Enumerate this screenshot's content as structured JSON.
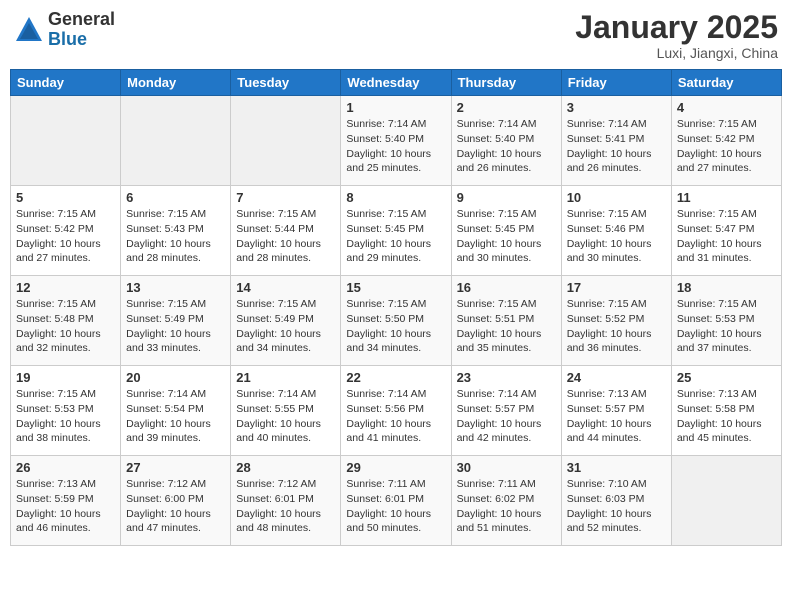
{
  "header": {
    "logo_general": "General",
    "logo_blue": "Blue",
    "month_title": "January 2025",
    "location": "Luxi, Jiangxi, China"
  },
  "weekdays": [
    "Sunday",
    "Monday",
    "Tuesday",
    "Wednesday",
    "Thursday",
    "Friday",
    "Saturday"
  ],
  "weeks": [
    [
      {
        "day": "",
        "info": ""
      },
      {
        "day": "",
        "info": ""
      },
      {
        "day": "",
        "info": ""
      },
      {
        "day": "1",
        "info": "Sunrise: 7:14 AM\nSunset: 5:40 PM\nDaylight: 10 hours\nand 25 minutes."
      },
      {
        "day": "2",
        "info": "Sunrise: 7:14 AM\nSunset: 5:40 PM\nDaylight: 10 hours\nand 26 minutes."
      },
      {
        "day": "3",
        "info": "Sunrise: 7:14 AM\nSunset: 5:41 PM\nDaylight: 10 hours\nand 26 minutes."
      },
      {
        "day": "4",
        "info": "Sunrise: 7:15 AM\nSunset: 5:42 PM\nDaylight: 10 hours\nand 27 minutes."
      }
    ],
    [
      {
        "day": "5",
        "info": "Sunrise: 7:15 AM\nSunset: 5:42 PM\nDaylight: 10 hours\nand 27 minutes."
      },
      {
        "day": "6",
        "info": "Sunrise: 7:15 AM\nSunset: 5:43 PM\nDaylight: 10 hours\nand 28 minutes."
      },
      {
        "day": "7",
        "info": "Sunrise: 7:15 AM\nSunset: 5:44 PM\nDaylight: 10 hours\nand 28 minutes."
      },
      {
        "day": "8",
        "info": "Sunrise: 7:15 AM\nSunset: 5:45 PM\nDaylight: 10 hours\nand 29 minutes."
      },
      {
        "day": "9",
        "info": "Sunrise: 7:15 AM\nSunset: 5:45 PM\nDaylight: 10 hours\nand 30 minutes."
      },
      {
        "day": "10",
        "info": "Sunrise: 7:15 AM\nSunset: 5:46 PM\nDaylight: 10 hours\nand 30 minutes."
      },
      {
        "day": "11",
        "info": "Sunrise: 7:15 AM\nSunset: 5:47 PM\nDaylight: 10 hours\nand 31 minutes."
      }
    ],
    [
      {
        "day": "12",
        "info": "Sunrise: 7:15 AM\nSunset: 5:48 PM\nDaylight: 10 hours\nand 32 minutes."
      },
      {
        "day": "13",
        "info": "Sunrise: 7:15 AM\nSunset: 5:49 PM\nDaylight: 10 hours\nand 33 minutes."
      },
      {
        "day": "14",
        "info": "Sunrise: 7:15 AM\nSunset: 5:49 PM\nDaylight: 10 hours\nand 34 minutes."
      },
      {
        "day": "15",
        "info": "Sunrise: 7:15 AM\nSunset: 5:50 PM\nDaylight: 10 hours\nand 34 minutes."
      },
      {
        "day": "16",
        "info": "Sunrise: 7:15 AM\nSunset: 5:51 PM\nDaylight: 10 hours\nand 35 minutes."
      },
      {
        "day": "17",
        "info": "Sunrise: 7:15 AM\nSunset: 5:52 PM\nDaylight: 10 hours\nand 36 minutes."
      },
      {
        "day": "18",
        "info": "Sunrise: 7:15 AM\nSunset: 5:53 PM\nDaylight: 10 hours\nand 37 minutes."
      }
    ],
    [
      {
        "day": "19",
        "info": "Sunrise: 7:15 AM\nSunset: 5:53 PM\nDaylight: 10 hours\nand 38 minutes."
      },
      {
        "day": "20",
        "info": "Sunrise: 7:14 AM\nSunset: 5:54 PM\nDaylight: 10 hours\nand 39 minutes."
      },
      {
        "day": "21",
        "info": "Sunrise: 7:14 AM\nSunset: 5:55 PM\nDaylight: 10 hours\nand 40 minutes."
      },
      {
        "day": "22",
        "info": "Sunrise: 7:14 AM\nSunset: 5:56 PM\nDaylight: 10 hours\nand 41 minutes."
      },
      {
        "day": "23",
        "info": "Sunrise: 7:14 AM\nSunset: 5:57 PM\nDaylight: 10 hours\nand 42 minutes."
      },
      {
        "day": "24",
        "info": "Sunrise: 7:13 AM\nSunset: 5:57 PM\nDaylight: 10 hours\nand 44 minutes."
      },
      {
        "day": "25",
        "info": "Sunrise: 7:13 AM\nSunset: 5:58 PM\nDaylight: 10 hours\nand 45 minutes."
      }
    ],
    [
      {
        "day": "26",
        "info": "Sunrise: 7:13 AM\nSunset: 5:59 PM\nDaylight: 10 hours\nand 46 minutes."
      },
      {
        "day": "27",
        "info": "Sunrise: 7:12 AM\nSunset: 6:00 PM\nDaylight: 10 hours\nand 47 minutes."
      },
      {
        "day": "28",
        "info": "Sunrise: 7:12 AM\nSunset: 6:01 PM\nDaylight: 10 hours\nand 48 minutes."
      },
      {
        "day": "29",
        "info": "Sunrise: 7:11 AM\nSunset: 6:01 PM\nDaylight: 10 hours\nand 50 minutes."
      },
      {
        "day": "30",
        "info": "Sunrise: 7:11 AM\nSunset: 6:02 PM\nDaylight: 10 hours\nand 51 minutes."
      },
      {
        "day": "31",
        "info": "Sunrise: 7:10 AM\nSunset: 6:03 PM\nDaylight: 10 hours\nand 52 minutes."
      },
      {
        "day": "",
        "info": ""
      }
    ]
  ]
}
